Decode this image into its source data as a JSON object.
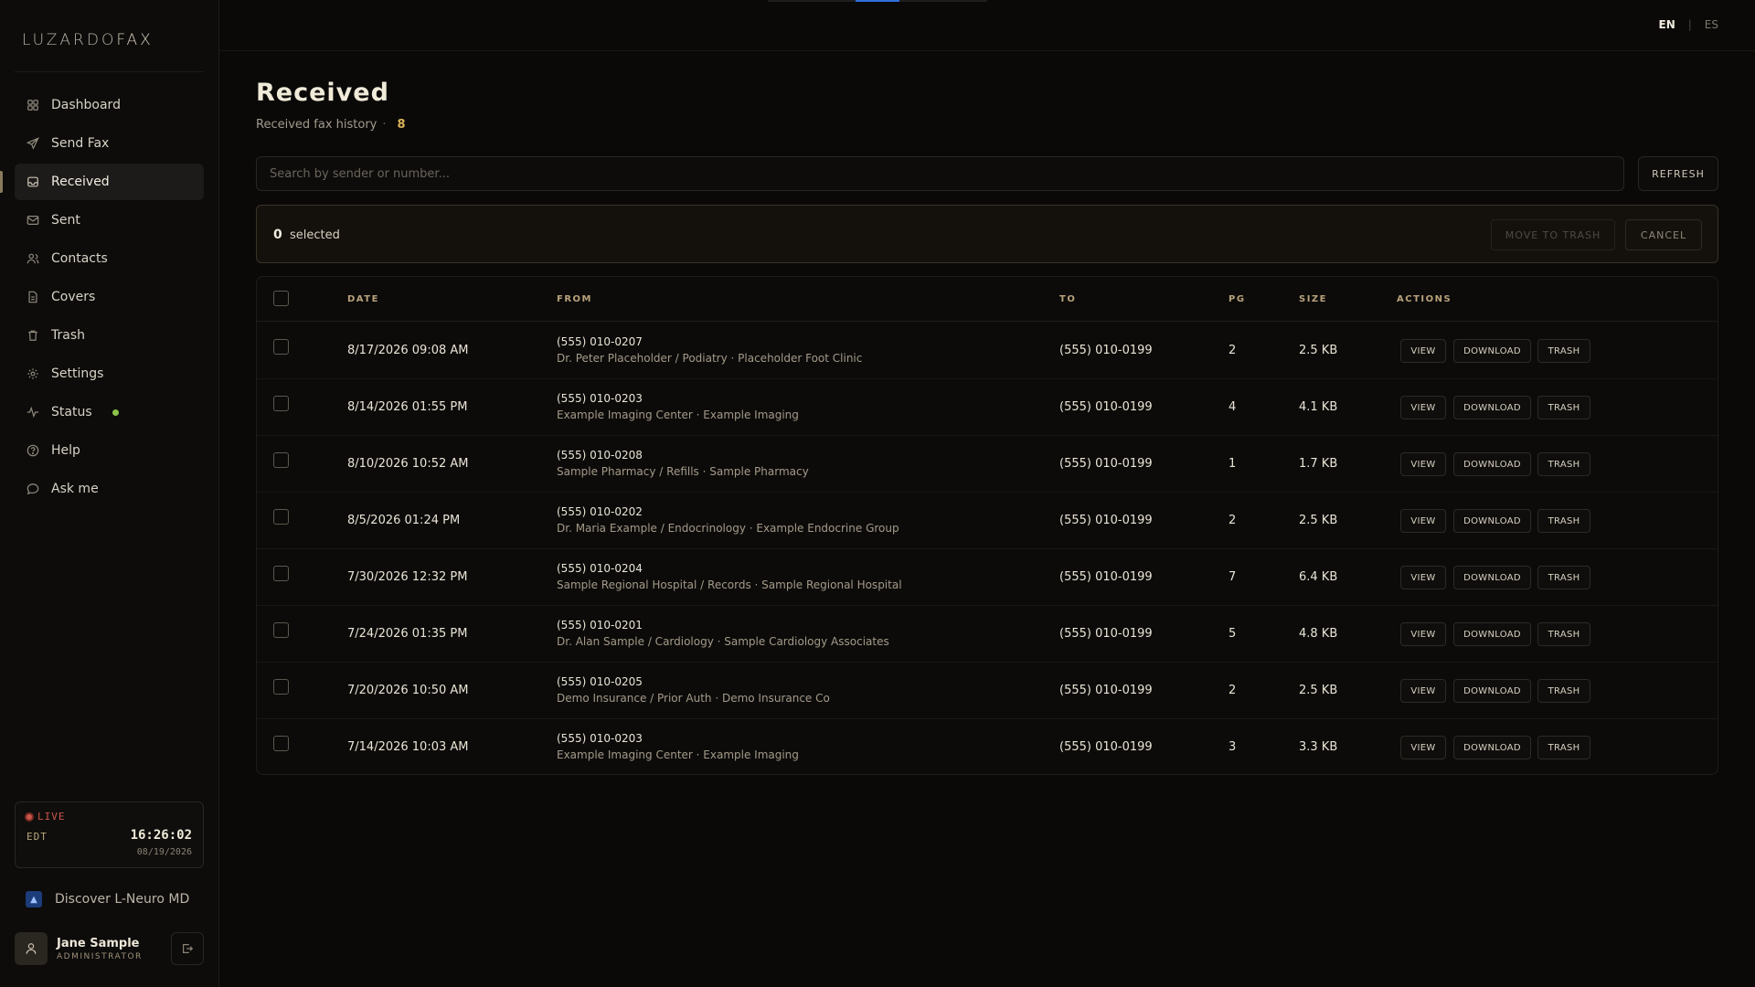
{
  "app": {
    "logo_main": "LUZARDO",
    "logo_accent": "FAX"
  },
  "sidebar": {
    "items": [
      {
        "label": "Dashboard",
        "icon": "grid-icon"
      },
      {
        "label": "Send Fax",
        "icon": "send-icon"
      },
      {
        "label": "Received",
        "icon": "inbox-icon",
        "active": true
      },
      {
        "label": "Sent",
        "icon": "mail-sent-icon"
      },
      {
        "label": "Contacts",
        "icon": "users-icon"
      },
      {
        "label": "Covers",
        "icon": "document-icon"
      },
      {
        "label": "Trash",
        "icon": "trash-icon"
      },
      {
        "label": "Settings",
        "icon": "gear-icon"
      },
      {
        "label": "Status",
        "icon": "pulse-icon",
        "status_color": "#8bc34a"
      },
      {
        "label": "Help",
        "icon": "help-icon"
      },
      {
        "label": "Ask me",
        "icon": "chat-icon"
      }
    ],
    "clock": {
      "live": "LIVE",
      "timezone": "EDT",
      "time": "16:26:02",
      "date": "08/19/2026"
    },
    "discover": "Discover L-Neuro MD",
    "user": {
      "name": "Jane Sample",
      "role": "ADMINISTRATOR"
    }
  },
  "topbar": {
    "lang_en": "EN",
    "lang_sep": "|",
    "lang_es": "ES"
  },
  "page": {
    "title": "Received",
    "subtitle": "Received fax history",
    "subtitle_sep": "·",
    "count": "8",
    "search_placeholder": "Search by sender or number...",
    "refresh": "REFRESH"
  },
  "selection": {
    "count": "0",
    "label": "selected",
    "move_to_trash": "MOVE TO TRASH",
    "cancel": "CANCEL"
  },
  "table": {
    "headers": {
      "date": "DATE",
      "from": "FROM",
      "to": "TO",
      "pg": "PG",
      "size": "SIZE",
      "actions": "ACTIONS"
    },
    "actions": {
      "view": "VIEW",
      "download": "DOWNLOAD",
      "trash": "TRASH"
    },
    "rows": [
      {
        "date": "8/17/2026 09:08 AM",
        "from": "(555) 010-0207",
        "sender": "Dr. Peter Placeholder / Podiatry · Placeholder Foot Clinic",
        "to": "(555) 010-0199",
        "pg": "2",
        "size": "2.5 KB"
      },
      {
        "date": "8/14/2026 01:55 PM",
        "from": "(555) 010-0203",
        "sender": "Example Imaging Center · Example Imaging",
        "to": "(555) 010-0199",
        "pg": "4",
        "size": "4.1 KB"
      },
      {
        "date": "8/10/2026 10:52 AM",
        "from": "(555) 010-0208",
        "sender": "Sample Pharmacy / Refills · Sample Pharmacy",
        "to": "(555) 010-0199",
        "pg": "1",
        "size": "1.7 KB"
      },
      {
        "date": "8/5/2026 01:24 PM",
        "from": "(555) 010-0202",
        "sender": "Dr. Maria Example / Endocrinology · Example Endocrine Group",
        "to": "(555) 010-0199",
        "pg": "2",
        "size": "2.5 KB"
      },
      {
        "date": "7/30/2026 12:32 PM",
        "from": "(555) 010-0204",
        "sender": "Sample Regional Hospital / Records · Sample Regional Hospital",
        "to": "(555) 010-0199",
        "pg": "7",
        "size": "6.4 KB"
      },
      {
        "date": "7/24/2026 01:35 PM",
        "from": "(555) 010-0201",
        "sender": "Dr. Alan Sample / Cardiology · Sample Cardiology Associates",
        "to": "(555) 010-0199",
        "pg": "5",
        "size": "4.8 KB"
      },
      {
        "date": "7/20/2026 10:50 AM",
        "from": "(555) 010-0205",
        "sender": "Demo Insurance / Prior Auth · Demo Insurance Co",
        "to": "(555) 010-0199",
        "pg": "2",
        "size": "2.5 KB"
      },
      {
        "date": "7/14/2026 10:03 AM",
        "from": "(555) 010-0203",
        "sender": "Example Imaging Center · Example Imaging",
        "to": "(555) 010-0199",
        "pg": "3",
        "size": "3.3 KB"
      }
    ]
  }
}
